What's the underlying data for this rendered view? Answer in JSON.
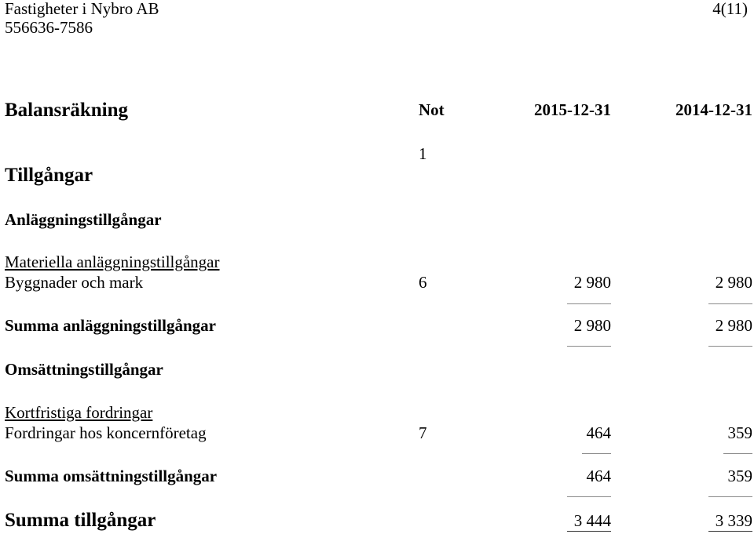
{
  "header": {
    "company": "Fastigheter i Nybro AB",
    "org_number": "556636-7586",
    "page": "4(11)"
  },
  "statement": {
    "title": "Balansräkning",
    "columns": {
      "note": "Not",
      "current": "2015-12-31",
      "previous": "2014-12-31"
    },
    "assets_heading": "Tillgångar",
    "assets_note": "1",
    "fixed_assets": {
      "heading": "Anläggningstillgångar",
      "subheading": "Materiella anläggningstillgångar",
      "rows": [
        {
          "label": "Byggnader och mark",
          "note": "6",
          "current": "2 980",
          "previous": "2 980"
        }
      ],
      "total": {
        "label": "Summa anläggningstillgångar",
        "current": "2 980",
        "previous": "2 980"
      }
    },
    "current_assets": {
      "heading": "Omsättningstillgångar",
      "subheading": "Kortfristiga fordringar",
      "rows": [
        {
          "label": "Fordringar hos koncernföretag",
          "note": "7",
          "current": "464",
          "previous": "359"
        }
      ],
      "total": {
        "label": "Summa omsättningstillgångar",
        "current": "464",
        "previous": "359"
      }
    },
    "grand_total": {
      "label": "Summa tillgångar",
      "current": "3 444",
      "previous": "3 339"
    }
  }
}
